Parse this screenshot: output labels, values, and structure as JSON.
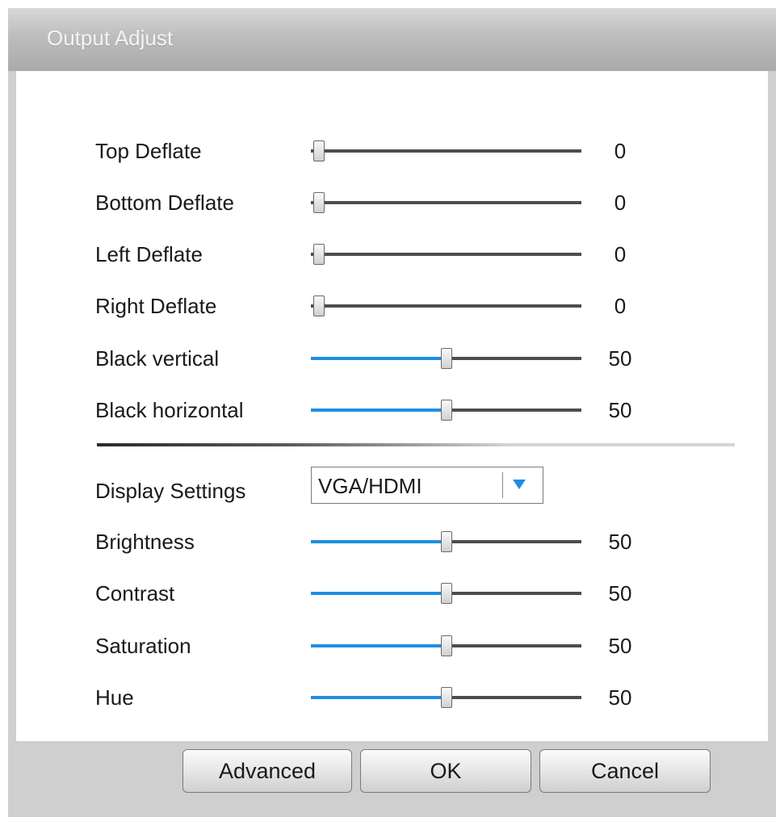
{
  "dialog": {
    "title": "Output Adjust"
  },
  "sliders_top": [
    {
      "label": "Top Deflate",
      "value": "0",
      "level": 0
    },
    {
      "label": "Bottom Deflate",
      "value": "0",
      "level": 0
    },
    {
      "label": "Left Deflate",
      "value": "0",
      "level": 0
    },
    {
      "label": "Right Deflate",
      "value": "0",
      "level": 0
    },
    {
      "label": "Black vertical",
      "value": "50",
      "level": 0.5
    },
    {
      "label": "Black horizontal",
      "value": "50",
      "level": 0.5
    }
  ],
  "display": {
    "label": "Display Settings",
    "selected": "VGA/HDMI",
    "arrow_icon": "triangle-down-icon"
  },
  "sliders_bottom": [
    {
      "label": "Brightness",
      "value": "50",
      "level": 0.5
    },
    {
      "label": "Contrast",
      "value": "50",
      "level": 0.5
    },
    {
      "label": "Saturation",
      "value": "50",
      "level": 0.5
    },
    {
      "label": "Hue",
      "value": "50",
      "level": 0.5
    }
  ],
  "buttons": {
    "advanced": "Advanced",
    "ok": "OK",
    "cancel": "Cancel"
  },
  "colors": {
    "slider_fill": "#1e8fe0",
    "slider_track": "#4d4d4d",
    "arrow": "#1e8fe0"
  }
}
